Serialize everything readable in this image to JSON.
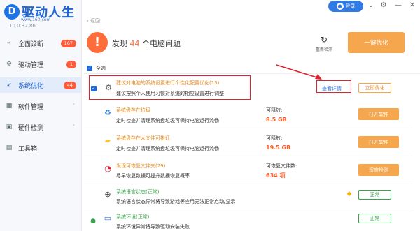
{
  "brand": {
    "name": "驱动人生",
    "url": "www.160.com",
    "version": "10.0.32.86",
    "logo_glyph": "D"
  },
  "sidebar": {
    "items": [
      {
        "label": "全面诊断",
        "badge": "167",
        "icon": "monitor-pulse-icon"
      },
      {
        "label": "驱动管理",
        "badge": "1",
        "icon": "driver-icon"
      },
      {
        "label": "系统优化",
        "badge": "44",
        "icon": "rocket-icon",
        "active": true
      },
      {
        "label": "软件管理",
        "badge": "",
        "icon": "apps-icon",
        "chevron": "˅"
      },
      {
        "label": "硬件检测",
        "badge": "",
        "icon": "hardware-icon",
        "chevron": "˅"
      },
      {
        "label": "工具箱",
        "badge": "",
        "icon": "toolbox-icon"
      }
    ]
  },
  "topbar": {
    "login_label": "登录",
    "icons": [
      "gear-icon",
      "minimize-icon",
      "close-icon"
    ]
  },
  "nav": {
    "back_label": "返回"
  },
  "header": {
    "found_prefix": "发现",
    "found_count": "44",
    "found_suffix": "个电脑问题",
    "rescan_label": "重新检测",
    "onekey_label": "一键优化"
  },
  "selectall_label": "全选",
  "rows": [
    {
      "title": "建议对电脑的系统设置进行个性化配置优化(13)",
      "desc": "建议按照个人使用习惯对系统的相应设置进行调整",
      "link": "查看详情",
      "button": "立即优化",
      "icon": "settings-icon"
    },
    {
      "title": "系统盘存在垃圾",
      "desc": "定时检查并清理系统盘垃圾可保持电脑运行流畅",
      "stat_label": "可释放:",
      "stat_value": "8.5 GB",
      "button": "打开软件",
      "icon": "recycle-bin-icon"
    },
    {
      "title": "系统盘存在大文件可搬迁",
      "desc": "定时检查并清理系统盘垃圾可保持电脑运行流畅",
      "stat_label": "可释放:",
      "stat_value": "19.5 GB",
      "button": "打开软件",
      "icon": "folder-icon"
    },
    {
      "title": "发现可恢复文件夹(29)",
      "desc": "尽早恢复数据可提升数据恢复概率",
      "stat_label": "可恢复文件数:",
      "stat_value": "634 项",
      "button": "深度检测",
      "icon": "recover-icon"
    },
    {
      "title": "系统语言状态(正常)",
      "desc": "系统语言状态异常将导致游戏等应用无法正常启动/显示",
      "button": "正常",
      "icon": "globe-icon"
    },
    {
      "title": "系统环境(正常)",
      "desc": "系统环境异常将导致驱动安装失败",
      "button": "正常",
      "icon": "computer-icon"
    }
  ],
  "colors": {
    "accent": "#1f66d6",
    "orange": "#f6a64c",
    "warn": "#ff5b24",
    "green": "#37a34a",
    "annotation": "#e0202a"
  }
}
